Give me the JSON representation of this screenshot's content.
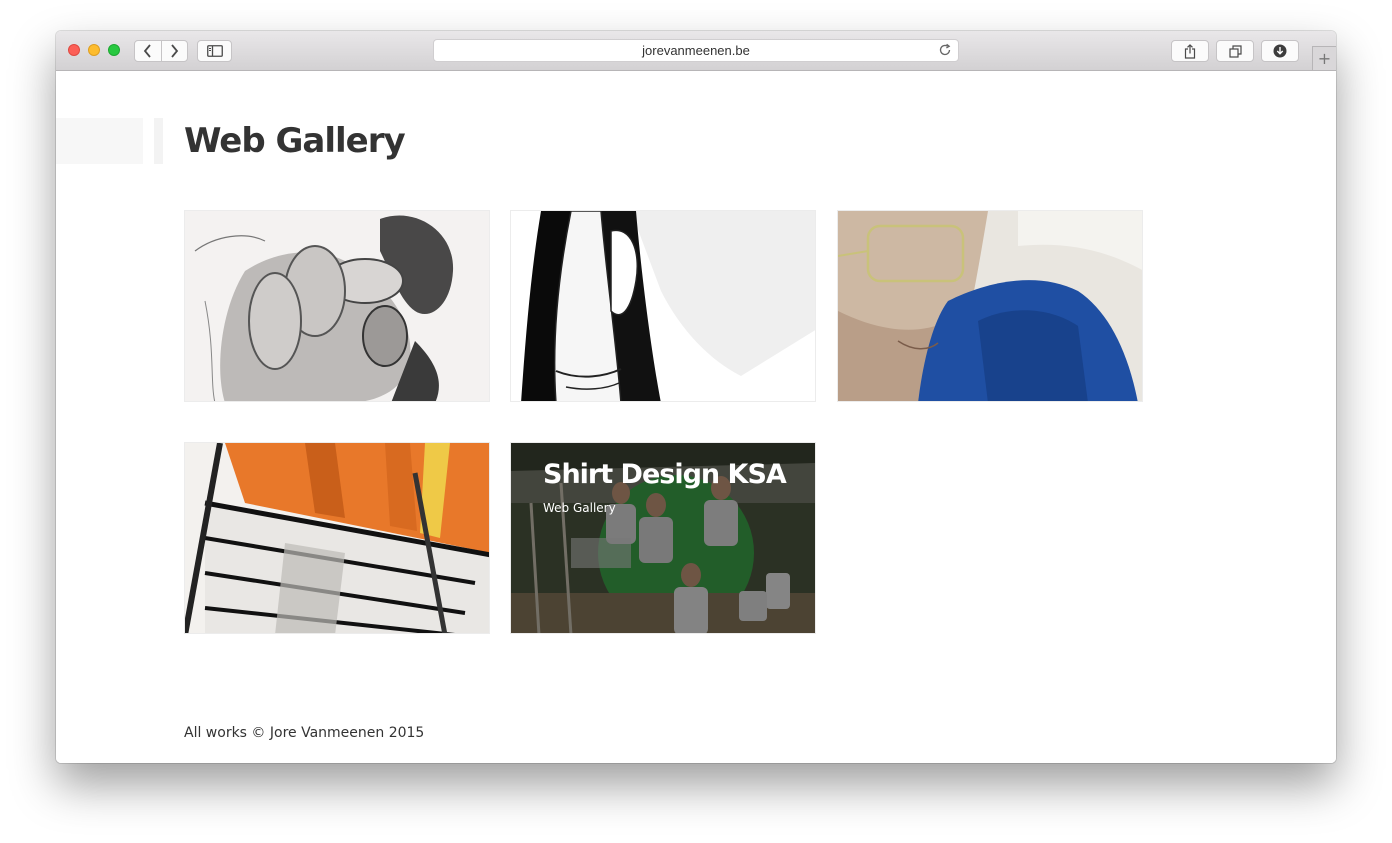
{
  "browser": {
    "url": "jorevanmeenen.be",
    "new_tab_glyph": "+",
    "icons": [
      "back-icon",
      "forward-icon",
      "sidebar-icon",
      "reload-icon",
      "share-icon",
      "tabs-icon",
      "download-icon"
    ]
  },
  "page": {
    "title": "Web Gallery",
    "gallery": [
      {
        "image": "pencil-fist-sketch"
      },
      {
        "image": "ink-figure-illustration"
      },
      {
        "image": "portrait-painting-blue-shirt"
      },
      {
        "image": "orange-building-drawing"
      },
      {
        "image": "shirt-design-group-photo",
        "title": "Shirt Design KSA",
        "category": "Web Gallery",
        "hovered": true
      }
    ],
    "footer": "All works © Jore Vanmeenen 2015"
  },
  "colors": {
    "title": "#333333",
    "traffic_red": "#fc5f57",
    "traffic_yellow": "#fdbc2e",
    "traffic_green": "#28c840"
  }
}
